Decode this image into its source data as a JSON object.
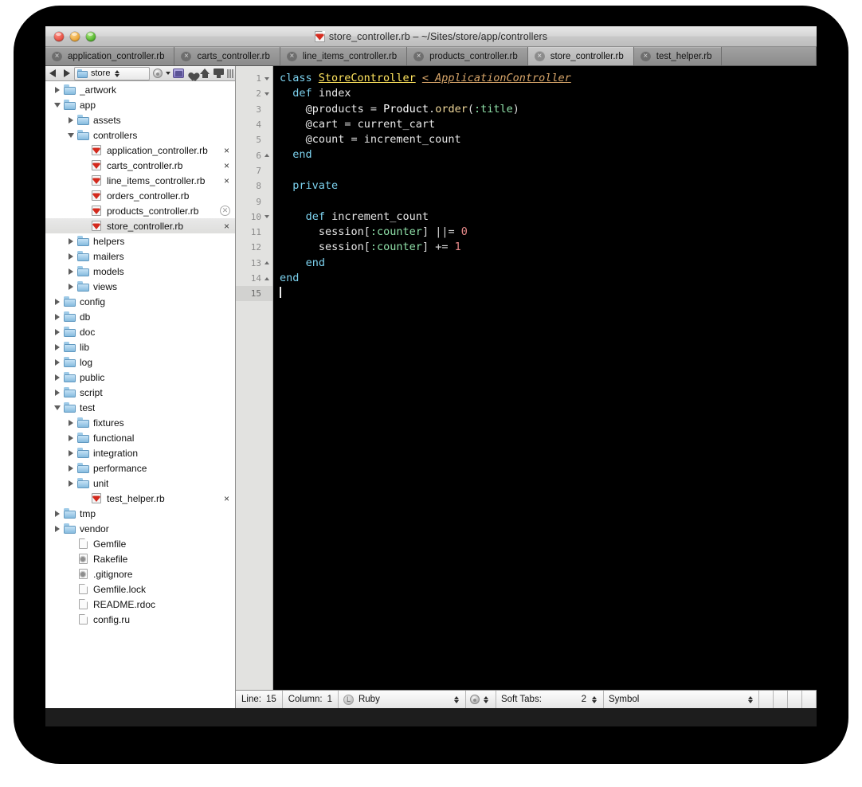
{
  "window": {
    "title": "store_controller.rb – ~/Sites/store/app/controllers",
    "title_icon": "ruby-file-icon",
    "traffic_lights": [
      "close-button",
      "minimize-button",
      "zoom-button"
    ]
  },
  "tabs": [
    {
      "label": "application_controller.rb",
      "active": false,
      "close": "×"
    },
    {
      "label": "carts_controller.rb",
      "active": false,
      "close": "×"
    },
    {
      "label": "line_items_controller.rb",
      "active": false,
      "close": "×"
    },
    {
      "label": "products_controller.rb",
      "active": false,
      "close": "×"
    },
    {
      "label": "store_controller.rb",
      "active": true,
      "close": "×"
    },
    {
      "label": "test_helper.rb",
      "active": false,
      "close": "×"
    }
  ],
  "sidebar": {
    "toolbar": {
      "back": "◀",
      "forward": "▶",
      "path_label": "store",
      "icons": [
        "gear-icon",
        "caret-down-icon",
        "project-folder-icon",
        "favorites-heart-icon",
        "home-icon",
        "display-icon",
        "resize-grip-icon"
      ]
    },
    "tree": [
      {
        "label": "_artwork",
        "depth": 0,
        "icon": "folder-icon",
        "twisty": "closed",
        "badge": ""
      },
      {
        "label": "app",
        "depth": 0,
        "icon": "folder-icon",
        "twisty": "open",
        "badge": ""
      },
      {
        "label": "assets",
        "depth": 1,
        "icon": "folder-icon",
        "twisty": "closed",
        "badge": ""
      },
      {
        "label": "controllers",
        "depth": 1,
        "icon": "folder-icon",
        "twisty": "open",
        "badge": ""
      },
      {
        "label": "application_controller.rb",
        "depth": 2,
        "icon": "ruby-icon",
        "twisty": "none",
        "badge": "×"
      },
      {
        "label": "carts_controller.rb",
        "depth": 2,
        "icon": "ruby-icon",
        "twisty": "none",
        "badge": "×"
      },
      {
        "label": "line_items_controller.rb",
        "depth": 2,
        "icon": "ruby-icon",
        "twisty": "none",
        "badge": "×"
      },
      {
        "label": "orders_controller.rb",
        "depth": 2,
        "icon": "ruby-icon",
        "twisty": "none",
        "badge": ""
      },
      {
        "label": "products_controller.rb",
        "depth": 2,
        "icon": "ruby-icon",
        "twisty": "none",
        "badge": "⊗"
      },
      {
        "label": "store_controller.rb",
        "depth": 2,
        "icon": "ruby-icon",
        "twisty": "none",
        "badge": "×",
        "selected": true
      },
      {
        "label": "helpers",
        "depth": 1,
        "icon": "folder-icon",
        "twisty": "closed",
        "badge": ""
      },
      {
        "label": "mailers",
        "depth": 1,
        "icon": "folder-icon",
        "twisty": "closed",
        "badge": ""
      },
      {
        "label": "models",
        "depth": 1,
        "icon": "folder-icon",
        "twisty": "closed",
        "badge": ""
      },
      {
        "label": "views",
        "depth": 1,
        "icon": "folder-icon",
        "twisty": "closed",
        "badge": ""
      },
      {
        "label": "config",
        "depth": 0,
        "icon": "folder-icon",
        "twisty": "closed",
        "badge": ""
      },
      {
        "label": "db",
        "depth": 0,
        "icon": "folder-icon",
        "twisty": "closed",
        "badge": ""
      },
      {
        "label": "doc",
        "depth": 0,
        "icon": "folder-icon",
        "twisty": "closed",
        "badge": ""
      },
      {
        "label": "lib",
        "depth": 0,
        "icon": "folder-icon",
        "twisty": "closed",
        "badge": ""
      },
      {
        "label": "log",
        "depth": 0,
        "icon": "folder-icon",
        "twisty": "closed",
        "badge": ""
      },
      {
        "label": "public",
        "depth": 0,
        "icon": "folder-icon",
        "twisty": "closed",
        "badge": ""
      },
      {
        "label": "script",
        "depth": 0,
        "icon": "folder-icon",
        "twisty": "closed",
        "badge": ""
      },
      {
        "label": "test",
        "depth": 0,
        "icon": "folder-icon",
        "twisty": "open",
        "badge": ""
      },
      {
        "label": "fixtures",
        "depth": 1,
        "icon": "folder-icon",
        "twisty": "closed",
        "badge": ""
      },
      {
        "label": "functional",
        "depth": 1,
        "icon": "folder-icon",
        "twisty": "closed",
        "badge": ""
      },
      {
        "label": "integration",
        "depth": 1,
        "icon": "folder-icon",
        "twisty": "closed",
        "badge": ""
      },
      {
        "label": "performance",
        "depth": 1,
        "icon": "folder-icon",
        "twisty": "closed",
        "badge": ""
      },
      {
        "label": "unit",
        "depth": 1,
        "icon": "folder-icon",
        "twisty": "closed",
        "badge": ""
      },
      {
        "label": "test_helper.rb",
        "depth": 2,
        "icon": "ruby-icon",
        "twisty": "none",
        "badge": "×"
      },
      {
        "label": "tmp",
        "depth": 0,
        "icon": "folder-icon",
        "twisty": "closed",
        "badge": ""
      },
      {
        "label": "vendor",
        "depth": 0,
        "icon": "folder-icon",
        "twisty": "closed",
        "badge": ""
      },
      {
        "label": "Gemfile",
        "depth": 1,
        "icon": "document-icon",
        "twisty": "none",
        "badge": ""
      },
      {
        "label": "Rakefile",
        "depth": 1,
        "icon": "config-icon",
        "twisty": "none",
        "badge": ""
      },
      {
        "label": ".gitignore",
        "depth": 1,
        "icon": "config-icon",
        "twisty": "none",
        "badge": ""
      },
      {
        "label": "Gemfile.lock",
        "depth": 1,
        "icon": "document-icon",
        "twisty": "none",
        "badge": ""
      },
      {
        "label": "README.rdoc",
        "depth": 1,
        "icon": "document-icon",
        "twisty": "none",
        "badge": ""
      },
      {
        "label": "config.ru",
        "depth": 1,
        "icon": "document-icon",
        "twisty": "none",
        "badge": ""
      }
    ]
  },
  "editor": {
    "gutter": [
      {
        "num": "1",
        "fold": "down"
      },
      {
        "num": "2",
        "fold": "down"
      },
      {
        "num": "3",
        "fold": "none"
      },
      {
        "num": "4",
        "fold": "none"
      },
      {
        "num": "5",
        "fold": "none"
      },
      {
        "num": "6",
        "fold": "up"
      },
      {
        "num": "7",
        "fold": "none"
      },
      {
        "num": "8",
        "fold": "none"
      },
      {
        "num": "9",
        "fold": "none"
      },
      {
        "num": "10",
        "fold": "down"
      },
      {
        "num": "11",
        "fold": "none"
      },
      {
        "num": "12",
        "fold": "none"
      },
      {
        "num": "13",
        "fold": "up"
      },
      {
        "num": "14",
        "fold": "up"
      },
      {
        "num": "15",
        "fold": "none",
        "current": true
      }
    ],
    "lines": [
      "class StoreController < ApplicationController",
      "  def index",
      "    @products = Product.order(:title)",
      "    @cart = current_cart",
      "    @count = increment_count",
      "  end",
      "",
      "  private",
      "",
      "    def increment_count",
      "      session[:counter] ||= 0",
      "      session[:counter] += 1",
      "    end",
      "end",
      ""
    ],
    "colors": {
      "background": "#000000",
      "gutter_background": "#e2e2e0",
      "keyword": "#7dd3f0",
      "class_name": "#ffe45e",
      "superclass": "#d8a66a",
      "symbol": "#8fe0a8",
      "number": "#e88a8a",
      "text": "#e8e8e8"
    }
  },
  "statusbar": {
    "line_label": "Line:",
    "line_value": "15",
    "column_label": "Column:",
    "column_value": "1",
    "language": "Ruby",
    "soft_tabs_label": "Soft Tabs:",
    "soft_tabs_value": "2",
    "symbol_label": "Symbol"
  }
}
